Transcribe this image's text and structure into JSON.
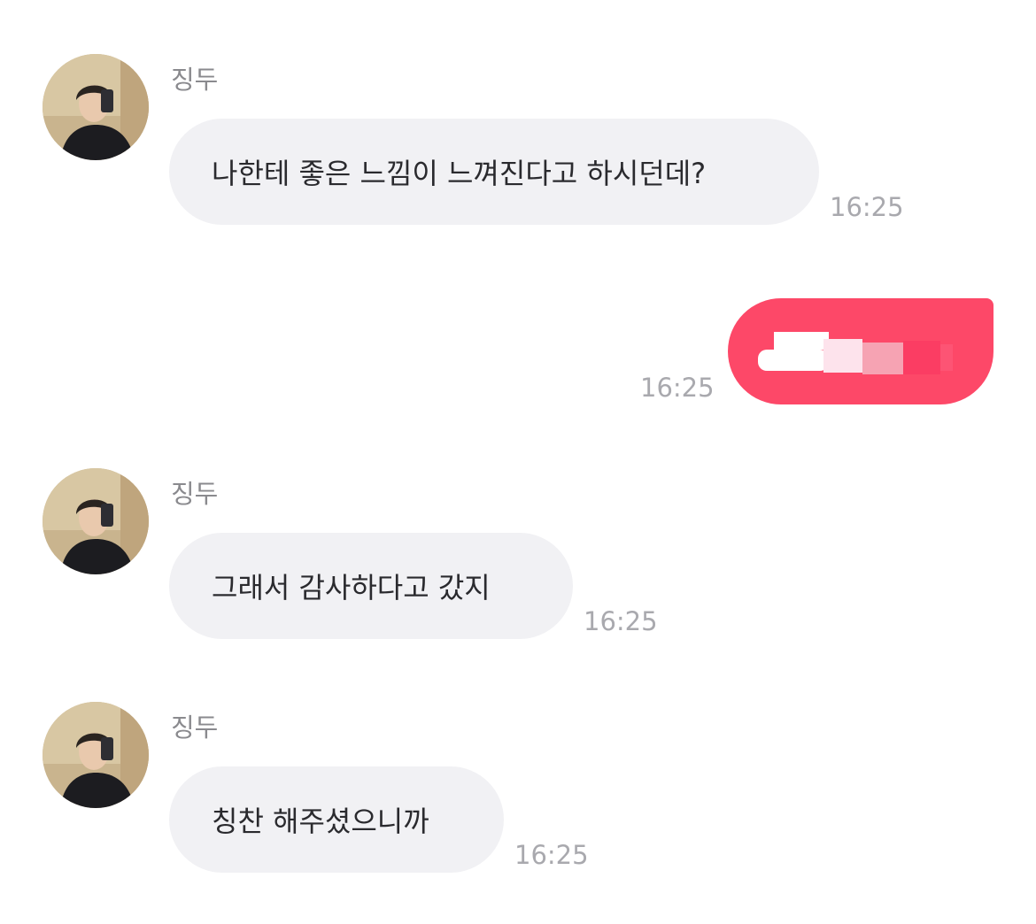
{
  "colors": {
    "incoming_bubble": "#f1f1f4",
    "outgoing_bubble": "#fd4868",
    "sender_name": "#8a8a8e",
    "timestamp": "#a9a9ae",
    "message_text": "#2a2a2e"
  },
  "messages": [
    {
      "direction": "incoming",
      "sender": "징두",
      "avatar": "user-avatar-photo",
      "text": "나한테 좋은 느낌이 느껴진다고 하시던데?",
      "time": "16:25"
    },
    {
      "direction": "outgoing",
      "text_redacted": true,
      "time": "16:25"
    },
    {
      "direction": "incoming",
      "sender": "징두",
      "avatar": "user-avatar-photo",
      "text": "그래서 감사하다고 갔지",
      "time": "16:25"
    },
    {
      "direction": "incoming",
      "sender": "징두",
      "avatar": "user-avatar-photo",
      "text": "칭찬 해주셨으니까",
      "time": "16:25"
    }
  ]
}
